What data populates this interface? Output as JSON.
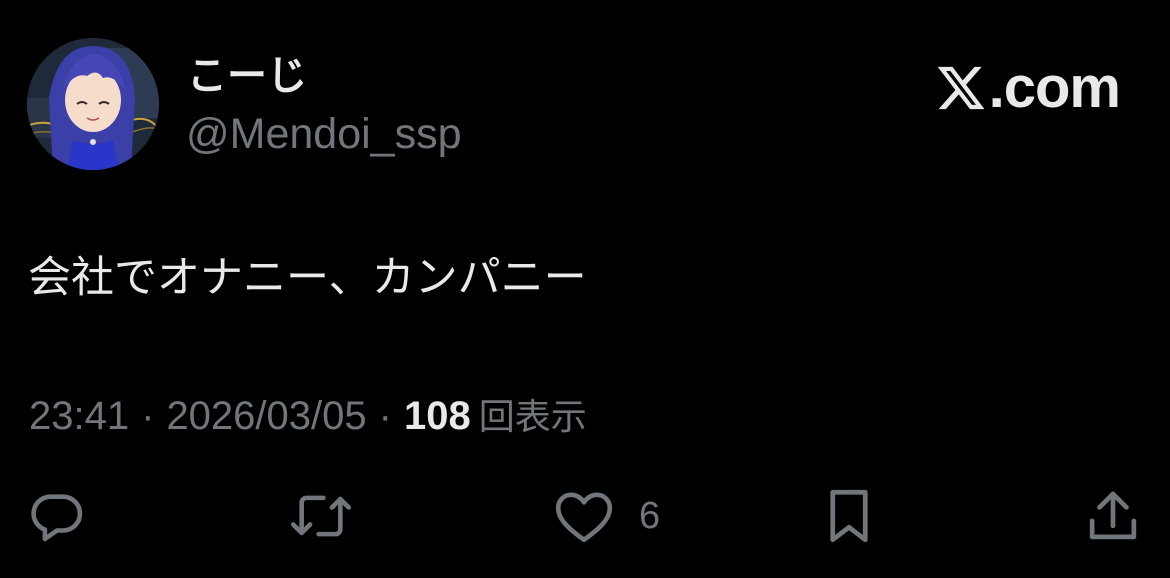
{
  "author": {
    "display_name": "こーじ",
    "handle": "@Mendoi_ssp",
    "avatar_icon": "avatar-anime-girl-blue-hair"
  },
  "brand": {
    "icon": "x-logo-icon",
    "text": ".com"
  },
  "tweet": {
    "text": "会社でオナニー、カンパニー"
  },
  "meta": {
    "time": "23:41",
    "separator": "·",
    "date": "2026/03/05",
    "views_count": "108",
    "views_label": "回表示"
  },
  "actions": {
    "reply": {
      "icon": "reply-icon"
    },
    "repost": {
      "icon": "repost-icon"
    },
    "like": {
      "icon": "heart-icon",
      "count": "6"
    },
    "bookmark": {
      "icon": "bookmark-icon"
    },
    "share": {
      "icon": "share-icon"
    }
  },
  "colors": {
    "background": "#000000",
    "primary_text": "#e7e9ea",
    "secondary_text": "#71767b",
    "avatar_hair": "#3b3fa8",
    "avatar_dress": "#2a35c9"
  }
}
